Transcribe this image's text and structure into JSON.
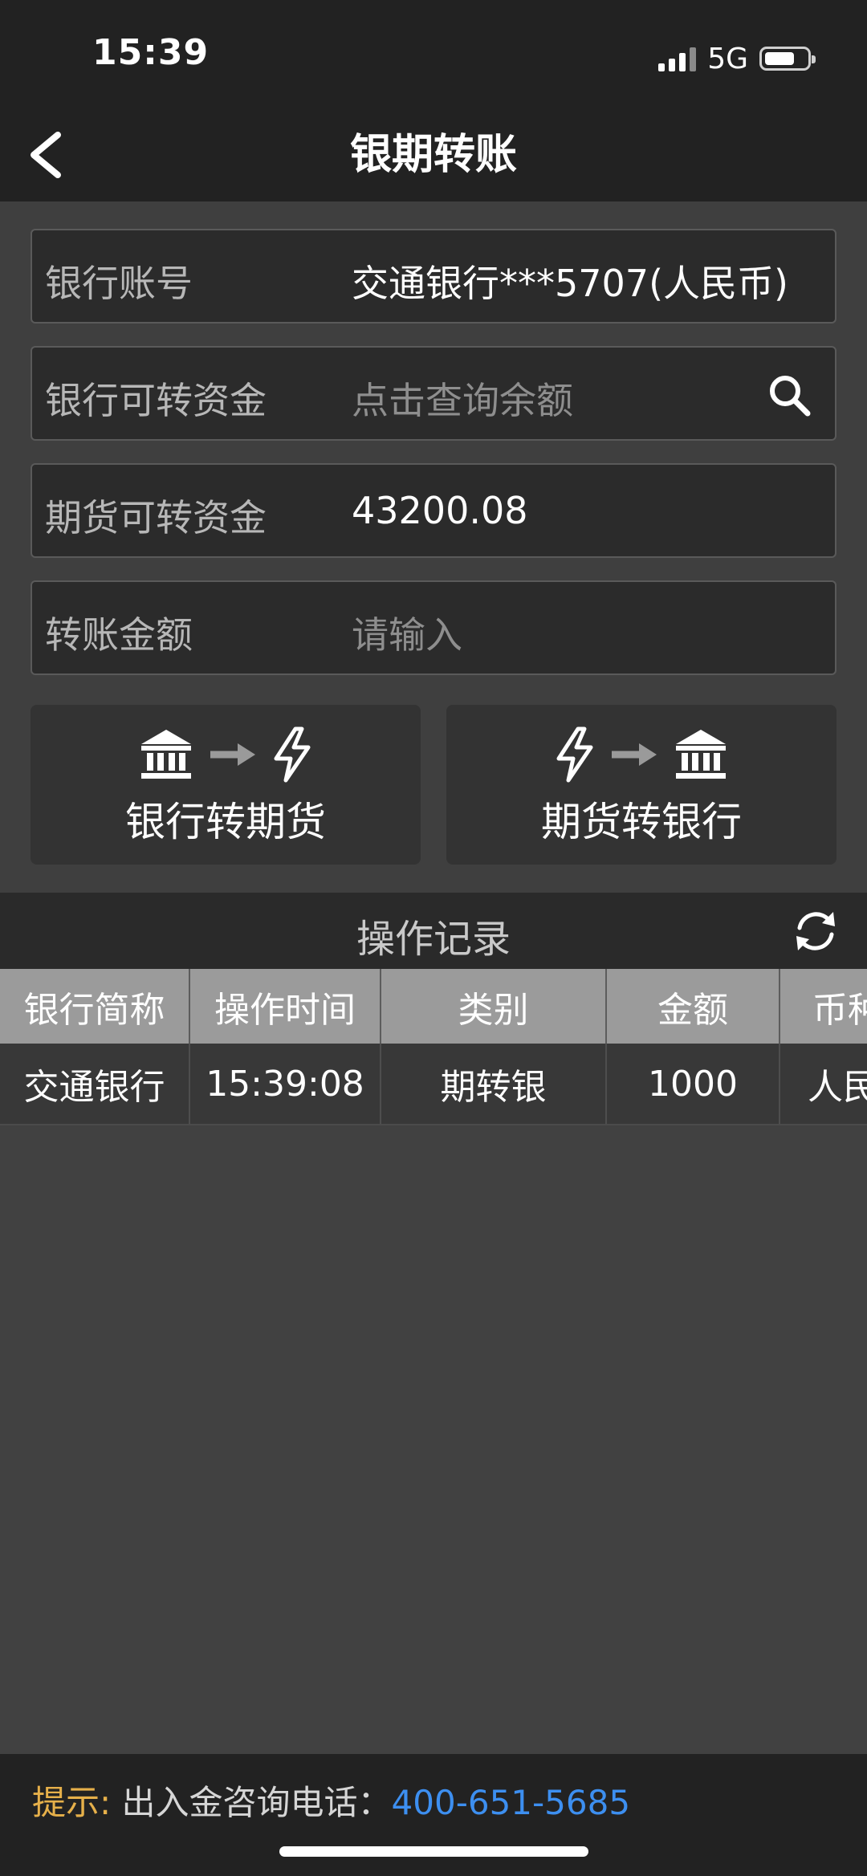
{
  "status": {
    "time": "15:39",
    "network": "5G"
  },
  "nav": {
    "title": "银期转账"
  },
  "form": {
    "rows": [
      {
        "label": "银行账号",
        "value": "交通银行***5707(人民币)"
      },
      {
        "label": "银行可转资金",
        "placeholder": "点击查询余额"
      },
      {
        "label": "期货可转资金",
        "value": "43200.08"
      },
      {
        "label": "转账金额",
        "placeholder": "请输入"
      }
    ]
  },
  "buttons": {
    "bank_to_futures": "银行转期货",
    "futures_to_bank": "期货转银行"
  },
  "records": {
    "title": "操作记录",
    "columns": [
      "银行简称",
      "操作时间",
      "类别",
      "金额",
      "币种"
    ],
    "rows": [
      [
        "交通银行",
        "15:39:08",
        "期转银",
        "1000",
        "人民币"
      ]
    ]
  },
  "footer": {
    "tip_label": "提示:",
    "tip_text": "出入金咨询电话：",
    "phone": "400-651-5685"
  },
  "colors": {
    "nav_bg": "#222222",
    "page_bg": "#414141",
    "tip_label": "#e6b04a",
    "phone_link": "#3d8ff0"
  }
}
